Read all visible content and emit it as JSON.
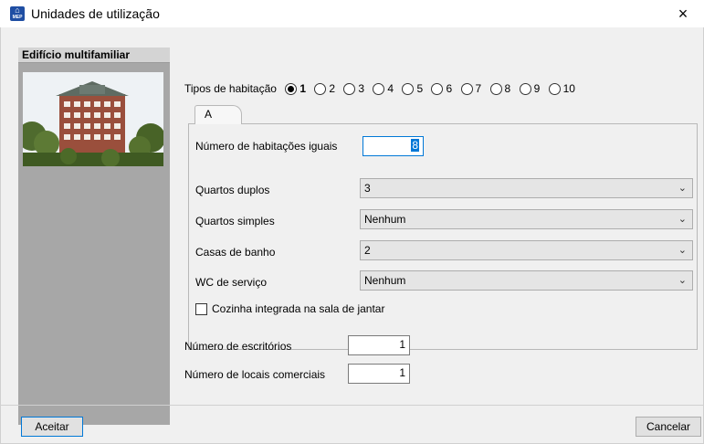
{
  "window": {
    "title": "Unidades de utilização",
    "icon_name": "mep-app-icon",
    "icon_text_top": "⌂",
    "icon_text_bottom": "MEP",
    "close_label": "×"
  },
  "left_panel": {
    "header": "Edifício multifamiliar",
    "image_alt": "building-photo"
  },
  "tipos": {
    "label": "Tipos de habitação",
    "options": [
      "1",
      "2",
      "3",
      "4",
      "5",
      "6",
      "7",
      "8",
      "9",
      "10"
    ],
    "selected": "1"
  },
  "tab": {
    "label": "A"
  },
  "form": {
    "num_habitacoes_label": "Número de habitações iguais",
    "num_habitacoes_value": "8",
    "quartos_duplos_label": "Quartos duplos",
    "quartos_duplos_value": "3",
    "quartos_simples_label": "Quartos simples",
    "quartos_simples_value": "Nenhum",
    "casas_banho_label": "Casas de banho",
    "casas_banho_value": "2",
    "wc_servico_label": "WC de serviço",
    "wc_servico_value": "Nenhum",
    "cozinha_label": "Cozinha integrada na sala de jantar",
    "cozinha_checked": false
  },
  "extra": {
    "escritorios_label": "Número de escritórios",
    "escritorios_value": "1",
    "comerciais_label": "Número de locais comerciais",
    "comerciais_value": "1"
  },
  "buttons": {
    "accept": "Aceitar",
    "cancel": "Cancelar"
  },
  "icons": {
    "dropdown": "chevron-down-icon",
    "close": "close-icon"
  }
}
